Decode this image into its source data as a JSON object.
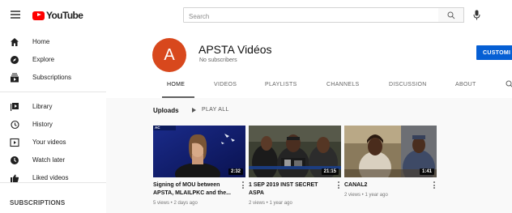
{
  "topbar": {
    "logo_text": "YouTube",
    "search_placeholder": "Search"
  },
  "sidebar": {
    "items": [
      {
        "label": "Home",
        "icon": "home-icon"
      },
      {
        "label": "Explore",
        "icon": "compass-icon"
      },
      {
        "label": "Subscriptions",
        "icon": "subscriptions-icon"
      },
      {
        "label": "Library",
        "icon": "library-icon"
      },
      {
        "label": "History",
        "icon": "history-icon"
      },
      {
        "label": "Your videos",
        "icon": "your-videos-icon"
      },
      {
        "label": "Watch later",
        "icon": "clock-icon"
      },
      {
        "label": "Liked videos",
        "icon": "thumbs-up-icon"
      }
    ],
    "subscriptions_heading": "SUBSCRIPTIONS"
  },
  "channel": {
    "avatar_letter": "A",
    "avatar_color": "#d8481d",
    "name": "APSTA Vidéos",
    "subscribers": "No subscribers",
    "customize_label": "CUSTOMI"
  },
  "tabs": [
    {
      "label": "HOME",
      "active": true
    },
    {
      "label": "VIDEOS",
      "active": false
    },
    {
      "label": "PLAYLISTS",
      "active": false
    },
    {
      "label": "CHANNELS",
      "active": false
    },
    {
      "label": "DISCUSSION",
      "active": false
    },
    {
      "label": "ABOUT",
      "active": false
    }
  ],
  "uploads": {
    "title": "Uploads",
    "play_all_label": "PLAY ALL"
  },
  "videos": [
    {
      "title": "Signing of MOU between APSTA, MLAILPKC and the...",
      "meta": "5 views • 2 days ago",
      "duration": "2:32",
      "thumb_badge": "AC"
    },
    {
      "title": "1 SEP 2019 INST SECRET ASPA",
      "meta": "2 views • 1 year ago",
      "duration": "21:15"
    },
    {
      "title": "CANAL2",
      "meta": "2 views • 1 year ago",
      "duration": "1:41"
    }
  ],
  "colors": {
    "brand_red": "#ff0000",
    "accent_blue": "#065fd4"
  }
}
